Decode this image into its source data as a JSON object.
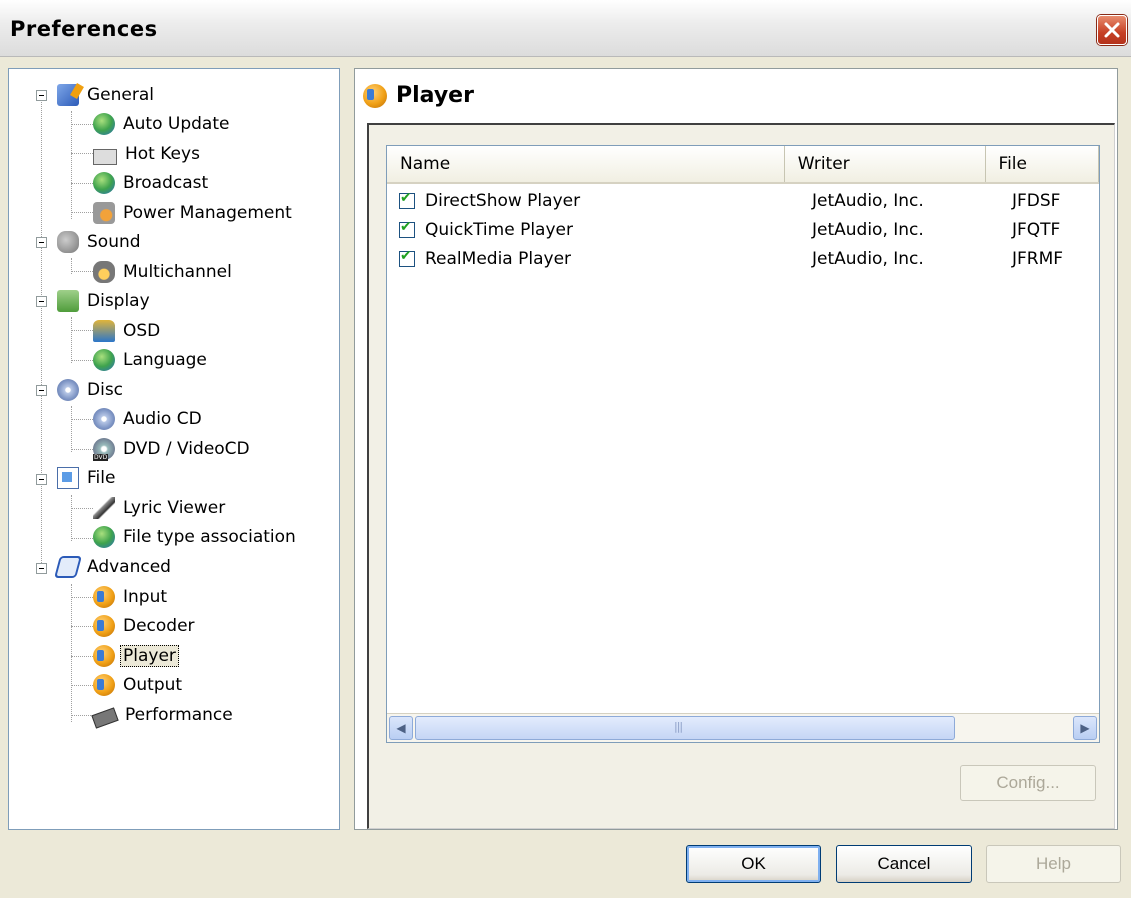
{
  "window": {
    "title": "Preferences"
  },
  "tree": [
    {
      "label": "General",
      "icon": "general-icon",
      "expanded": true
    },
    {
      "label": "Auto Update",
      "icon": "globe-icon"
    },
    {
      "label": "Hot Keys",
      "icon": "keyboard-icon"
    },
    {
      "label": "Broadcast",
      "icon": "broadcast-icon"
    },
    {
      "label": "Power Management",
      "icon": "power-icon"
    },
    {
      "label": "Sound",
      "icon": "speaker-icon",
      "expanded": true
    },
    {
      "label": "Multichannel",
      "icon": "multichannel-icon"
    },
    {
      "label": "Display",
      "icon": "display-icon",
      "expanded": true
    },
    {
      "label": "OSD",
      "icon": "osd-icon"
    },
    {
      "label": "Language",
      "icon": "globe-icon"
    },
    {
      "label": "Disc",
      "icon": "disc-icon",
      "expanded": true
    },
    {
      "label": "Audio CD",
      "icon": "cd-icon"
    },
    {
      "label": "DVD / VideoCD",
      "icon": "dvd-icon"
    },
    {
      "label": "File",
      "icon": "file-icon",
      "expanded": true
    },
    {
      "label": "Lyric Viewer",
      "icon": "microphone-icon"
    },
    {
      "label": "File type association",
      "icon": "file-association-icon"
    },
    {
      "label": "Advanced",
      "icon": "advanced-icon",
      "expanded": true
    },
    {
      "label": "Input",
      "icon": "plugin-icon"
    },
    {
      "label": "Decoder",
      "icon": "plugin-icon"
    },
    {
      "label": "Player",
      "icon": "plugin-icon",
      "selected": true
    },
    {
      "label": "Output",
      "icon": "plugin-icon"
    },
    {
      "label": "Performance",
      "icon": "chip-icon"
    }
  ],
  "panel": {
    "title": "Player",
    "icon": "plugin-icon"
  },
  "list": {
    "columns": [
      "Name",
      "Writer",
      "File"
    ],
    "rows": [
      {
        "checked": true,
        "name": "DirectShow Player",
        "writer": "JetAudio, Inc.",
        "file": "JFDSF"
      },
      {
        "checked": true,
        "name": "QuickTime Player",
        "writer": "JetAudio, Inc.",
        "file": "JFQTF"
      },
      {
        "checked": true,
        "name": "RealMedia Player",
        "writer": "JetAudio, Inc.",
        "file": "JFRMF"
      }
    ]
  },
  "buttons": {
    "config": "Config...",
    "ok": "OK",
    "cancel": "Cancel",
    "help": "Help"
  }
}
